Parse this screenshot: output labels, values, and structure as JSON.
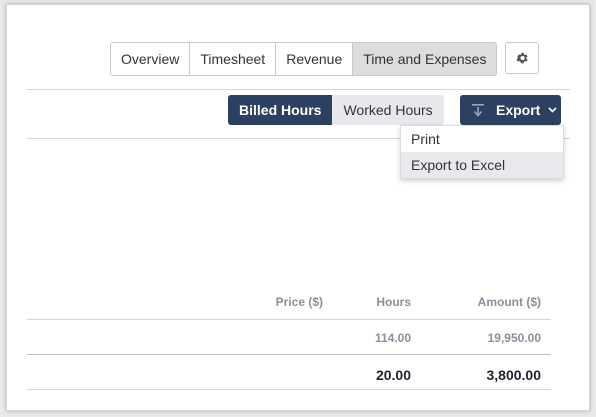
{
  "tabs": [
    {
      "label": "Overview",
      "active": false
    },
    {
      "label": "Timesheet",
      "active": false
    },
    {
      "label": "Revenue",
      "active": false
    },
    {
      "label": "Time and Expenses",
      "active": true
    }
  ],
  "settings_icon": "gear-icon",
  "toggle": {
    "billed": "Billed Hours",
    "worked": "Worked Hours",
    "selected": "Billed Hours"
  },
  "export": {
    "label": "Export",
    "icon": "download-icon",
    "menu": [
      {
        "label": "Print"
      },
      {
        "label": "Export to Excel",
        "hovered": true
      }
    ]
  },
  "table": {
    "headers": {
      "price": "Price ($)",
      "hours": "Hours",
      "amount": "Amount ($)"
    },
    "rows": [
      {
        "hours": "114.00",
        "amount": "19,950.00"
      }
    ],
    "total": {
      "hours": "20.00",
      "amount": "3,800.00"
    }
  },
  "colors": {
    "primary": "#2c4162",
    "active_tab": "#dddddd",
    "muted_text": "#8a8f99"
  }
}
